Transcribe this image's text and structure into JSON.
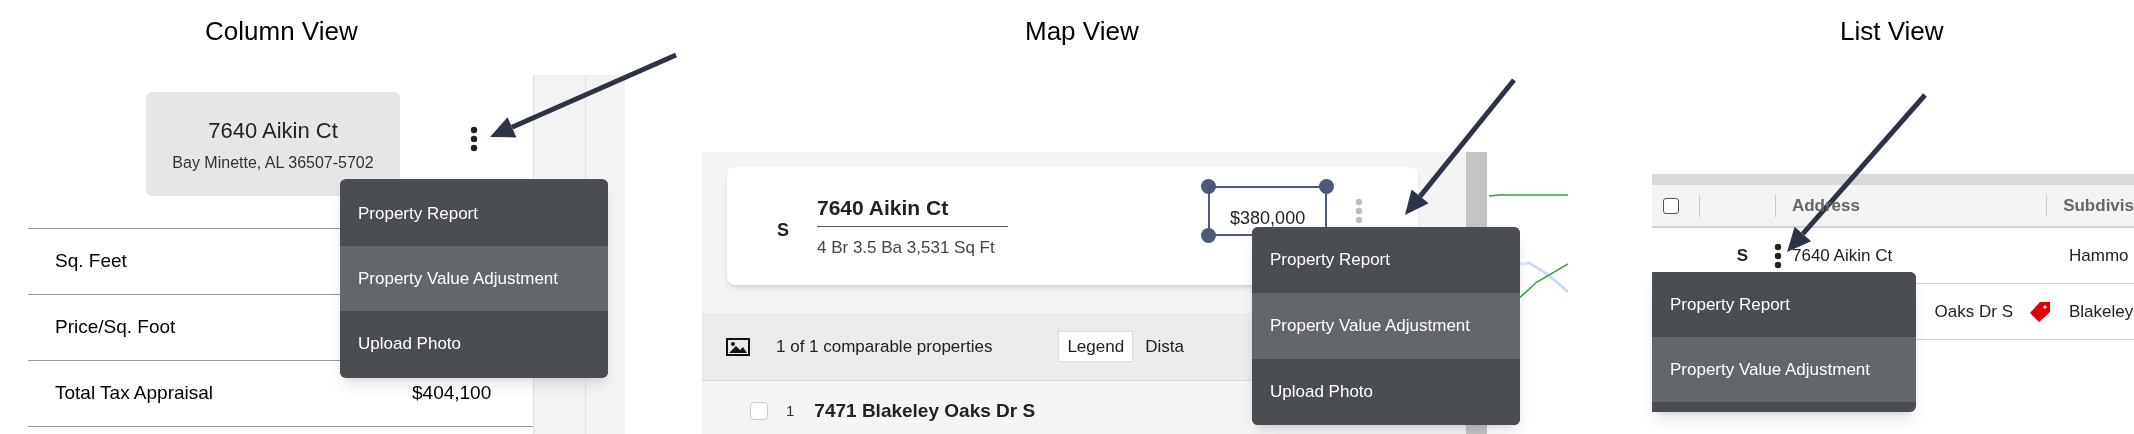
{
  "panels": [
    {
      "kind": "column",
      "title": "Column View",
      "address": {
        "street": "7640 Aikin Ct",
        "city": "Bay Minette, AL 36507-5702"
      },
      "rows": [
        {
          "label": "Sq. Feet"
        },
        {
          "label": "Price/Sq. Foot"
        },
        {
          "label": "Total Tax Appraisal",
          "value": "$404,100"
        }
      ],
      "menu": [
        {
          "label": "Property Report",
          "selected": false
        },
        {
          "label": "Property Value Adjustment",
          "selected": true
        },
        {
          "label": "Upload Photo",
          "selected": false
        }
      ]
    },
    {
      "kind": "map",
      "title": "Map View",
      "card": {
        "status": "S",
        "street": "7640 Aikin Ct",
        "details": "4 Br 3.5 Ba 3,531 Sq Ft",
        "price": "$380,000"
      },
      "toolbar": {
        "count": "1 of 1 comparable properties",
        "legend": "Legend",
        "column_2": "Dista"
      },
      "next_row": {
        "checked": false,
        "number": "1",
        "street": "7471 Blakeley Oaks Dr S"
      },
      "menu": [
        {
          "label": "Property Report",
          "selected": false
        },
        {
          "label": "Property Value Adjustment",
          "selected": true
        },
        {
          "label": "Upload Photo",
          "selected": false
        }
      ]
    },
    {
      "kind": "list",
      "title": "List View",
      "select_all_checked": false,
      "columns": [
        "Address",
        "Subdivis"
      ],
      "rows": [
        {
          "status": "S",
          "address": "7640 Aikin Ct",
          "subdivision": "Hammo",
          "tag": false
        },
        {
          "address": "Oaks Dr S",
          "subdivision": "Blakeley",
          "tag": true
        }
      ],
      "menu": [
        {
          "label": "Property Report",
          "selected": false
        },
        {
          "label": "Property Value Adjustment",
          "selected": true
        }
      ]
    }
  ]
}
